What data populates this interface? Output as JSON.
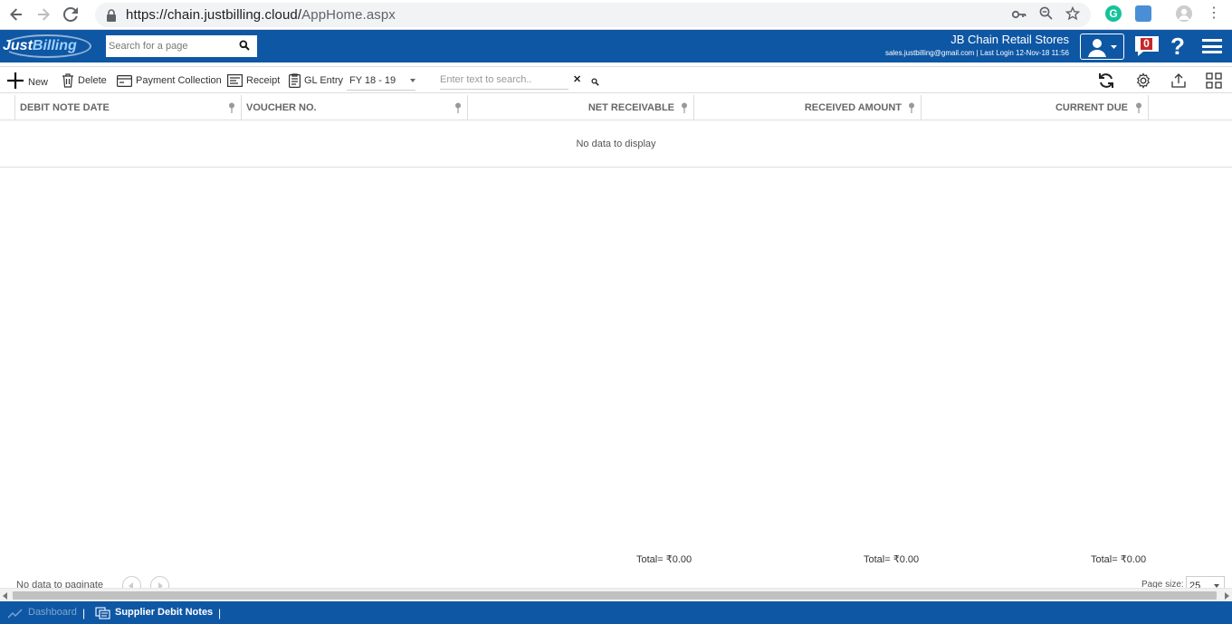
{
  "browser": {
    "url_host": "https://chain.justbilling.cloud/",
    "url_path": "AppHome.aspx",
    "grammarly_letter": "G"
  },
  "header": {
    "logo_part1": "Just",
    "logo_part2": "Billing",
    "page_search_placeholder": "Search for a page",
    "store_name": "JB Chain Retail Stores",
    "store_meta": "sales.justbilling@gmail.com | Last Login 12-Nov-18 11:56",
    "notification_count": "0",
    "help_label": "?"
  },
  "toolbar": {
    "new_label": "New",
    "delete_label": "Delete",
    "payment_label": "Payment Collection",
    "receipt_label": "Receipt",
    "gl_label": "GL Entry",
    "fy_value": "FY 18 - 19",
    "search_placeholder": "Enter text to search..",
    "clear_label": "✕"
  },
  "grid": {
    "columns": [
      {
        "label": "DEBIT NOTE DATE"
      },
      {
        "label": "VOUCHER NO."
      },
      {
        "label": "NET RECEIVABLE"
      },
      {
        "label": "RECEIVED AMOUNT"
      },
      {
        "label": "CURRENT DUE"
      }
    ],
    "no_data": "No data to display",
    "totals": [
      "Total= ₹0.00",
      "Total= ₹0.00",
      "Total= ₹0.00"
    ],
    "pager_text": "No data to paginate",
    "page_size_label": "Page size:",
    "page_size_value": "25"
  },
  "footer": {
    "dashboard": "Dashboard",
    "current": "Supplier Debit Notes",
    "separator": "|"
  },
  "colors": {
    "brand_blue": "#0e57a4",
    "border": "#dddddd"
  }
}
